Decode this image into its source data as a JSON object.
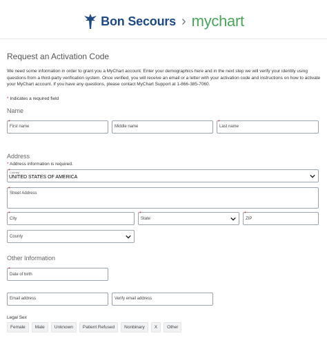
{
  "header": {
    "brand": "Bon Secours",
    "separator": "›",
    "product": "mychart"
  },
  "page": {
    "title": "Request an Activation Code",
    "intro": "We need some information in order to grant you a MyChart account. Enter your demographics here and in the next step we will verify your identity using questions from a third-party verification system. Once verified, you will receive an email or a letter with your activation code and instructions on how to activate your MyChart account. If you have any questions, please contact MyChart Support at 1-866-385-7060.",
    "required_note": "Indicates a required field",
    "required_mark": "*"
  },
  "name_section": {
    "heading": "Name",
    "first_name": "First name",
    "middle_name": "Middle name",
    "last_name": "Last name"
  },
  "address_section": {
    "heading": "Address",
    "required_note": "Address information is required.",
    "country_label": "Country",
    "country_value": "UNITED STATES OF AMERICA",
    "street": "Street Address",
    "city": "City",
    "state": "State",
    "zip": "ZIP",
    "county": "County"
  },
  "other_section": {
    "heading": "Other Information",
    "dob": "Date of birth",
    "email": "Email address",
    "verify_email": "Verify email address",
    "legal_sex_label": "Legal Sex",
    "legal_sex_options": [
      "Female",
      "Male",
      "Unknown",
      "Patient Refused",
      "Nonbinary",
      "X",
      "Other"
    ]
  },
  "colors": {
    "brand_blue": "#1d4a86",
    "mychart_green": "#4aa55a",
    "required_red": "#d0202f"
  }
}
